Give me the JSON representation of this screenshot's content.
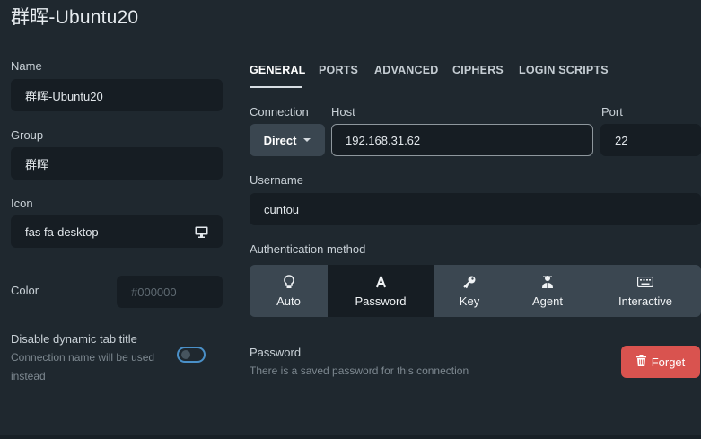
{
  "title": "群晖-Ubuntu20",
  "left": {
    "name_label": "Name",
    "name_value": "群晖-Ubuntu20",
    "group_label": "Group",
    "group_value": "群晖",
    "icon_label": "Icon",
    "icon_value": "fas fa-desktop",
    "icon_preview": "desktop-icon",
    "color_label": "Color",
    "color_placeholder": "#000000",
    "dynamic_title_label": "Disable dynamic tab title",
    "dynamic_title_help_1": "Connection name will be used",
    "dynamic_title_help_2": "instead",
    "dynamic_title_toggle": false
  },
  "tabs": [
    {
      "label": "GENERAL",
      "active": true
    },
    {
      "label": "PORTS",
      "active": false
    },
    {
      "label": "ADVANCED",
      "active": false
    },
    {
      "label": "CIPHERS",
      "active": false
    },
    {
      "label": "LOGIN SCRIPTS",
      "active": false
    }
  ],
  "connection": {
    "connection_label": "Connection",
    "connection_value": "Direct",
    "host_label": "Host",
    "host_value": "192.168.31.62",
    "port_label": "Port",
    "port_value": "22",
    "username_label": "Username",
    "username_value": "cuntou"
  },
  "auth": {
    "label": "Authentication method",
    "options": [
      {
        "label": "Auto",
        "icon": "lightbulb-icon",
        "active": false
      },
      {
        "label": "Password",
        "icon": "font-icon",
        "active": true
      },
      {
        "label": "Key",
        "icon": "key-icon",
        "active": false
      },
      {
        "label": "Agent",
        "icon": "agent-icon",
        "active": false
      },
      {
        "label": "Interactive",
        "icon": "keyboard-icon",
        "active": false
      }
    ]
  },
  "password": {
    "label": "Password",
    "help": "There is a saved password for this connection",
    "forget_label": "Forget",
    "forget_icon": "trash-icon"
  },
  "colors": {
    "background": "#1f282f",
    "field": "#161d23",
    "accent": "#4a90c8",
    "danger": "#d9534f"
  }
}
